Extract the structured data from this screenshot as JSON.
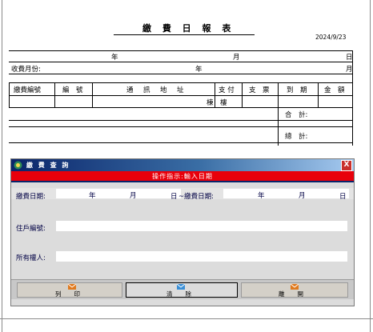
{
  "report": {
    "title": "繳 費 日 報 表",
    "date": "2024/9/23",
    "row1": {
      "year": "年",
      "month": "月",
      "day": "日"
    },
    "row2": {
      "label": "收費月份:",
      "year": "年",
      "month": "月"
    },
    "headers": [
      "繳費編號",
      "編　號",
      "通　訊　地　址",
      "支 付",
      "支　票",
      "到　期",
      "金　額"
    ],
    "subheader": "棟　樓",
    "subtotal_label": "合　計:",
    "total_label": "總　計:"
  },
  "dialog": {
    "title": "繳 費 查 詢",
    "close": "X",
    "banner": "操作指示:輸入日期",
    "date_from_label": "繳費日期:",
    "date_to_label": "~繳費日期:",
    "year": "年",
    "month": "月",
    "day": "日",
    "household_label": "住戶編號:",
    "owner_label": "所有權人:",
    "buttons": {
      "print": [
        "列",
        "印"
      ],
      "clear": [
        "清",
        "除"
      ],
      "exit": [
        "離",
        "開"
      ]
    }
  },
  "colors": {
    "titlebar_start": "#0a246a",
    "banner": "#e8000b",
    "dialog_bg": "#dcdcdc"
  }
}
